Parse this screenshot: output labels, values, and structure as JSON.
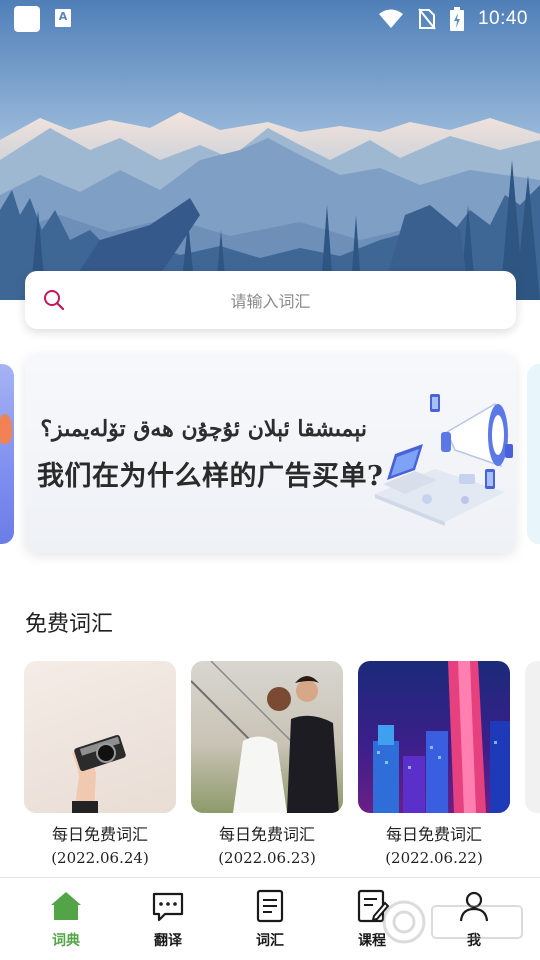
{
  "status_bar": {
    "time": "10:40",
    "app_badge": "A",
    "icons": [
      "app-square-icon",
      "a-badge-icon",
      "wifi-icon",
      "no-sim-icon",
      "battery-charging-icon"
    ]
  },
  "search": {
    "placeholder": "请输入词汇"
  },
  "banner": {
    "uyghur_text": "نېمىشقا ئېلان ئۇچۇن ھەق تۆلەيمىز؟",
    "chinese_text": "我们在为什么样的广告买单?"
  },
  "free_vocab": {
    "title": "免费词汇",
    "cards": [
      {
        "title": "每日免费词汇",
        "date": "(2022.06.24)"
      },
      {
        "title": "每日免费词汇",
        "date": "(2022.06.23)"
      },
      {
        "title": "每日免费词汇",
        "date": "(2022.06.22)"
      }
    ]
  },
  "bottom_nav": {
    "active_color": "#52a447",
    "items": [
      {
        "label": "词典",
        "icon": "home-icon",
        "active": true
      },
      {
        "label": "翻译",
        "icon": "chat-bubble-icon",
        "active": false
      },
      {
        "label": "词汇",
        "icon": "document-icon",
        "active": false
      },
      {
        "label": "课程",
        "icon": "edit-document-icon",
        "active": false
      },
      {
        "label": "我",
        "icon": "person-icon",
        "active": false
      }
    ]
  }
}
